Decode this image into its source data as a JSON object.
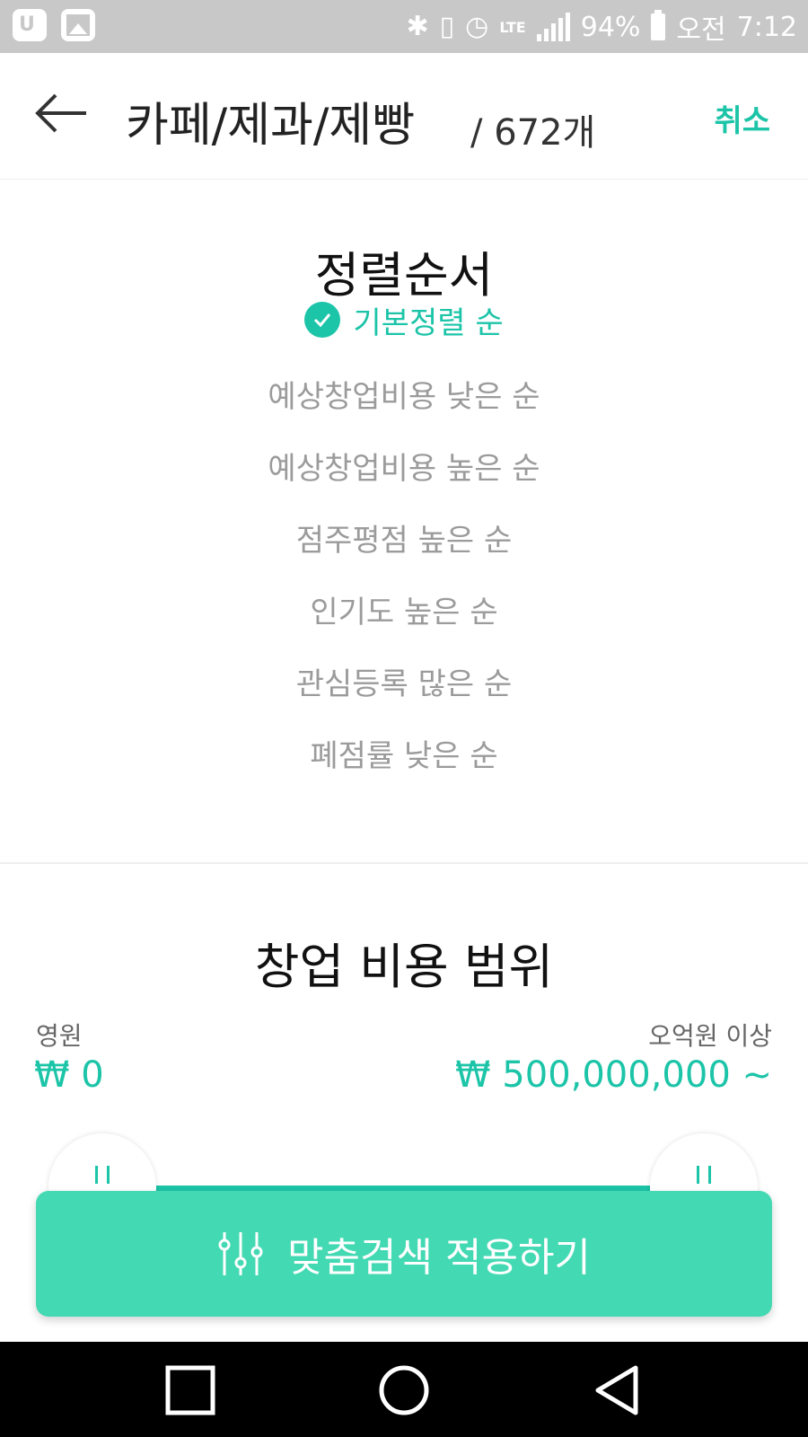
{
  "statusbar": {
    "battery_percent": "94%",
    "ampm": "오전",
    "time": "7:12",
    "network": "LTE"
  },
  "header": {
    "title": "카페/제과/제빵",
    "count": "/ 672개",
    "cancel_label": "취소"
  },
  "sort": {
    "title": "정렬순서",
    "options": [
      {
        "label": "기본정렬 순",
        "selected": true
      },
      {
        "label": "예상창업비용 낮은 순",
        "selected": false
      },
      {
        "label": "예상창업비용 높은 순",
        "selected": false
      },
      {
        "label": "점주평점 높은 순",
        "selected": false
      },
      {
        "label": "인기도 높은 순",
        "selected": false
      },
      {
        "label": "관심등록 많은 순",
        "selected": false
      },
      {
        "label": "폐점률 낮은 순",
        "selected": false
      }
    ]
  },
  "cost": {
    "title": "창업 비용 범위",
    "min_label": "영원",
    "max_label": "오억원 이상",
    "min_value": "₩ 0",
    "max_value": "₩ 500,000,000 ~"
  },
  "apply": {
    "label": "맞춤검색 적용하기"
  },
  "colors": {
    "accent": "#1cc4a8",
    "button": "#43d9b3",
    "statusbar": "#c8c8c8"
  }
}
